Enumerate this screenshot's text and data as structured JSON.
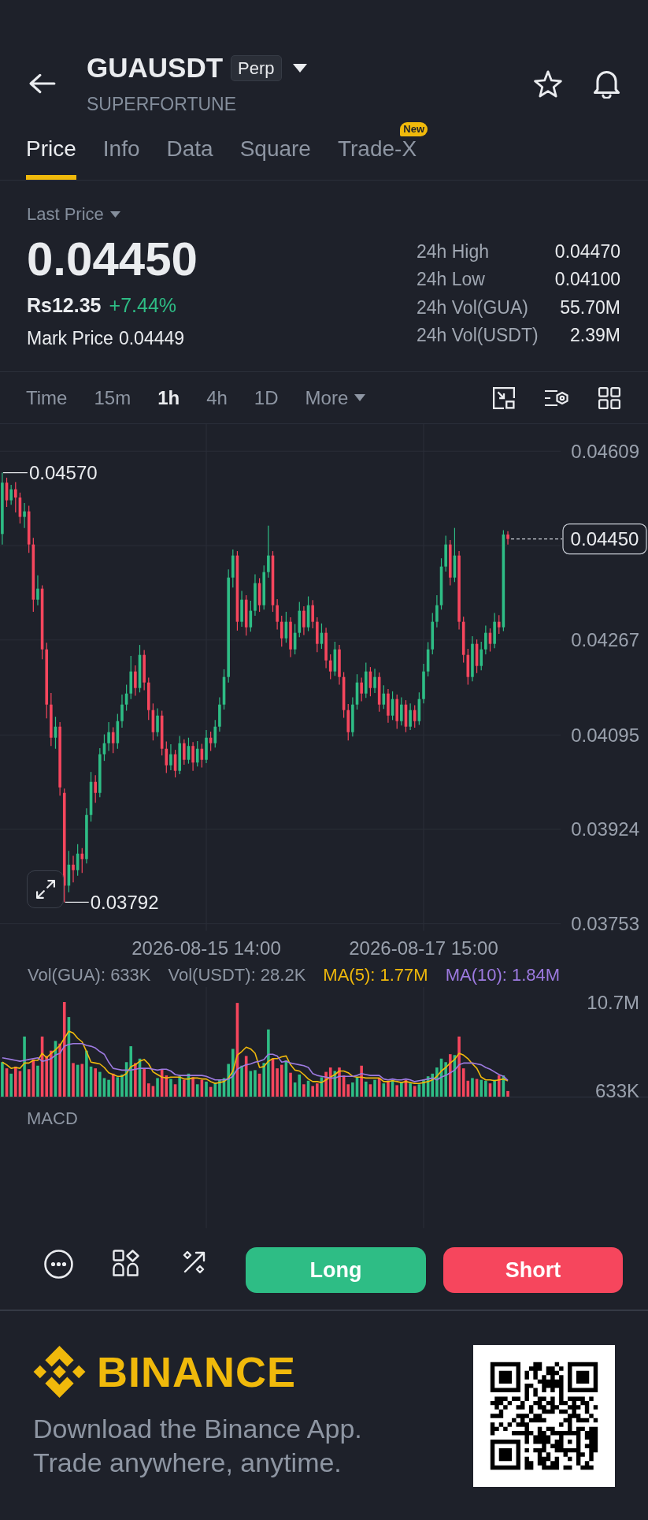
{
  "header": {
    "title": "GUAUSDT",
    "contract_type": "Perp",
    "subtitle": "SUPERFORTUNE"
  },
  "tabs": [
    {
      "label": "Price",
      "selected": true
    },
    {
      "label": "Info",
      "selected": false
    },
    {
      "label": "Data",
      "selected": false
    },
    {
      "label": "Square",
      "selected": false
    },
    {
      "label": "Trade-X",
      "selected": false,
      "badge": "New"
    }
  ],
  "summary": {
    "price_label": "Last Price",
    "last_price": "0.04450",
    "local_price": "Rs12.35",
    "change": "+7.44%",
    "mark_price_label": "Mark Price",
    "mark_price": "0.04449",
    "stats": [
      {
        "label": "24h High",
        "value": "0.04470"
      },
      {
        "label": "24h Low",
        "value": "0.04100"
      },
      {
        "label": "24h Vol(GUA)",
        "value": "55.70M"
      },
      {
        "label": "24h Vol(USDT)",
        "value": "2.39M"
      }
    ]
  },
  "intervals": [
    {
      "label": "Time",
      "kind": "option",
      "selected": false
    },
    {
      "label": "15m",
      "kind": "option",
      "selected": false
    },
    {
      "label": "1h",
      "kind": "option",
      "selected": true
    },
    {
      "label": "4h",
      "kind": "option",
      "selected": false
    },
    {
      "label": "1D",
      "kind": "option",
      "selected": false
    },
    {
      "label": "More",
      "kind": "dropdown",
      "selected": false
    }
  ],
  "chart": {
    "high_marker": "0.04570",
    "low_marker": "0.03792",
    "current_price": "0.04450",
    "chart_data": {
      "type": "candlestick",
      "grid": true,
      "ylim": [
        0.03753,
        0.04609
      ],
      "categories": [
        null,
        null,
        null,
        null,
        null,
        null,
        null,
        null,
        null,
        null,
        null,
        null,
        null,
        null,
        null,
        null,
        null,
        null,
        null,
        null,
        null,
        null,
        null,
        null,
        null,
        null,
        null,
        null,
        null,
        null,
        null,
        null,
        null,
        null,
        null,
        null,
        null,
        null,
        null,
        null,
        null,
        null,
        null,
        null,
        null,
        null,
        "2026-08-15 14:00",
        null,
        null,
        null,
        null,
        null,
        null,
        null,
        null,
        null,
        null,
        null,
        null,
        null,
        null,
        null,
        null,
        null,
        null,
        null,
        null,
        null,
        null,
        null,
        null,
        null,
        null,
        null,
        null,
        null,
        null,
        null,
        null,
        null,
        null,
        null,
        null,
        null,
        null,
        null,
        null,
        null,
        null,
        null,
        null,
        null,
        null,
        null,
        null,
        "2026-08-17 15:00",
        null,
        null,
        null,
        null,
        null,
        null,
        null,
        null,
        null,
        null,
        null,
        null,
        null,
        null,
        null,
        null,
        null,
        null,
        null
      ],
      "ohlc": [
        [
          0.04459,
          0.0457,
          0.0444,
          0.04552
        ],
        [
          0.04552,
          0.04561,
          0.04508,
          0.0452
        ],
        [
          0.0452,
          0.04548,
          0.04512,
          0.0454
        ],
        [
          0.0454,
          0.04553,
          0.04498,
          0.04525
        ],
        [
          0.04525,
          0.04534,
          0.04478,
          0.0449
        ],
        [
          0.0449,
          0.04515,
          0.0447,
          0.045
        ],
        [
          0.045,
          0.0451,
          0.04425,
          0.0444
        ],
        [
          0.0444,
          0.04452,
          0.04318,
          0.0434
        ],
        [
          0.0434,
          0.04384,
          0.0433,
          0.0436
        ],
        [
          0.0436,
          0.04366,
          0.04232,
          0.0425
        ],
        [
          0.0425,
          0.04262,
          0.04125,
          0.0415
        ],
        [
          0.0415,
          0.04171,
          0.04075,
          0.0409
        ],
        [
          0.0409,
          0.04128,
          0.0407,
          0.0411
        ],
        [
          0.0411,
          0.04118,
          0.03985,
          0.04
        ],
        [
          0.0399,
          0.03998,
          0.03792,
          0.03822
        ],
        [
          0.03822,
          0.03885,
          0.0381,
          0.0386
        ],
        [
          0.0386,
          0.03876,
          0.03828,
          0.0385
        ],
        [
          0.0385,
          0.03897,
          0.0384,
          0.0388
        ],
        [
          0.0388,
          0.0389,
          0.03845,
          0.0387
        ],
        [
          0.0387,
          0.03962,
          0.03862,
          0.0395
        ],
        [
          0.0395,
          0.04028,
          0.03938,
          0.0401
        ],
        [
          0.0401,
          0.04022,
          0.03972,
          0.0399
        ],
        [
          0.0399,
          0.04071,
          0.03982,
          0.0406
        ],
        [
          0.0406,
          0.04096,
          0.04048,
          0.0408
        ],
        [
          0.0408,
          0.04118,
          0.04066,
          0.041
        ],
        [
          0.041,
          0.04109,
          0.04062,
          0.0408
        ],
        [
          0.0408,
          0.04133,
          0.0407,
          0.0412
        ],
        [
          0.0412,
          0.04168,
          0.04108,
          0.0415
        ],
        [
          0.0415,
          0.04186,
          0.04139,
          0.0417
        ],
        [
          0.0417,
          0.04238,
          0.0416,
          0.0421
        ],
        [
          0.0421,
          0.04221,
          0.04166,
          0.0418
        ],
        [
          0.0418,
          0.04258,
          0.04172,
          0.0424
        ],
        [
          0.0424,
          0.04249,
          0.04176,
          0.0419
        ],
        [
          0.0419,
          0.04199,
          0.04122,
          0.0414
        ],
        [
          0.0414,
          0.04152,
          0.04085,
          0.041
        ],
        [
          0.041,
          0.04143,
          0.04092,
          0.0413
        ],
        [
          0.0413,
          0.04139,
          0.04058,
          0.0407
        ],
        [
          0.0407,
          0.04083,
          0.04026,
          0.0404
        ],
        [
          0.0404,
          0.04078,
          0.04031,
          0.0406
        ],
        [
          0.0406,
          0.04068,
          0.04018,
          0.0403
        ],
        [
          0.0403,
          0.04093,
          0.04024,
          0.0408
        ],
        [
          0.0408,
          0.04087,
          0.04041,
          0.0405
        ],
        [
          0.0405,
          0.0409,
          0.04043,
          0.04075
        ],
        [
          0.04075,
          0.04082,
          0.0403,
          0.04045
        ],
        [
          0.04045,
          0.04084,
          0.04038,
          0.0407
        ],
        [
          0.0407,
          0.04079,
          0.04036,
          0.0405
        ],
        [
          0.0405,
          0.04104,
          0.04044,
          0.0409
        ],
        [
          0.0409,
          0.04101,
          0.04066,
          0.0408
        ],
        [
          0.0408,
          0.04122,
          0.04072,
          0.0411
        ],
        [
          0.0411,
          0.04163,
          0.04101,
          0.0415
        ],
        [
          0.0415,
          0.04214,
          0.04141,
          0.042
        ],
        [
          0.042,
          0.04395,
          0.0419,
          0.0438
        ],
        [
          0.0438,
          0.04431,
          0.04362,
          0.0442
        ],
        [
          0.0442,
          0.04428,
          0.04284,
          0.043
        ],
        [
          0.043,
          0.04356,
          0.04291,
          0.0434
        ],
        [
          0.0434,
          0.04348,
          0.04275,
          0.0429
        ],
        [
          0.0429,
          0.04338,
          0.04282,
          0.0432
        ],
        [
          0.0432,
          0.04386,
          0.04311,
          0.0437
        ],
        [
          0.0437,
          0.04379,
          0.04318,
          0.0433
        ],
        [
          0.0433,
          0.04402,
          0.04322,
          0.0439
        ],
        [
          0.0439,
          0.04474,
          0.0438,
          0.0442
        ],
        [
          0.0442,
          0.04428,
          0.04318,
          0.0433
        ],
        [
          0.0433,
          0.04341,
          0.04286,
          0.043
        ],
        [
          0.043,
          0.04311,
          0.04255,
          0.0427
        ],
        [
          0.0427,
          0.04318,
          0.04262,
          0.043
        ],
        [
          0.043,
          0.04308,
          0.04236,
          0.0425
        ],
        [
          0.0425,
          0.04296,
          0.04241,
          0.0428
        ],
        [
          0.0428,
          0.04336,
          0.04272,
          0.0432
        ],
        [
          0.0432,
          0.04328,
          0.04276,
          0.0429
        ],
        [
          0.0429,
          0.04346,
          0.04283,
          0.0433
        ],
        [
          0.0433,
          0.04339,
          0.04288,
          0.043
        ],
        [
          0.043,
          0.04308,
          0.04245,
          0.0426
        ],
        [
          0.0426,
          0.04297,
          0.04251,
          0.0428
        ],
        [
          0.0428,
          0.04289,
          0.04216,
          0.0423
        ],
        [
          0.0423,
          0.04241,
          0.04196,
          0.0421
        ],
        [
          0.0421,
          0.04264,
          0.04202,
          0.0425
        ],
        [
          0.0425,
          0.04258,
          0.04186,
          0.042
        ],
        [
          0.042,
          0.04209,
          0.04126,
          0.0414
        ],
        [
          0.0414,
          0.04151,
          0.04085,
          0.041
        ],
        [
          0.041,
          0.04163,
          0.04092,
          0.0415
        ],
        [
          0.0415,
          0.04205,
          0.04141,
          0.0419
        ],
        [
          0.0419,
          0.04199,
          0.04156,
          0.0417
        ],
        [
          0.0417,
          0.04226,
          0.04162,
          0.0421
        ],
        [
          0.0421,
          0.04218,
          0.04165,
          0.0418
        ],
        [
          0.0418,
          0.04215,
          0.04171,
          0.042
        ],
        [
          0.042,
          0.04208,
          0.04137,
          0.0415
        ],
        [
          0.0415,
          0.04185,
          0.04142,
          0.0417
        ],
        [
          0.0417,
          0.04178,
          0.04117,
          0.0413
        ],
        [
          0.0413,
          0.04174,
          0.04122,
          0.0416
        ],
        [
          0.0416,
          0.04168,
          0.04106,
          0.0412
        ],
        [
          0.0412,
          0.04163,
          0.04112,
          0.0415
        ],
        [
          0.0415,
          0.04158,
          0.041,
          0.0411
        ],
        [
          0.0411,
          0.04152,
          0.04104,
          0.0414
        ],
        [
          0.0414,
          0.04149,
          0.04108,
          0.0412
        ],
        [
          0.0412,
          0.04172,
          0.04113,
          0.0416
        ],
        [
          0.0416,
          0.04224,
          0.04152,
          0.0421
        ],
        [
          0.0421,
          0.04263,
          0.04201,
          0.0425
        ],
        [
          0.0425,
          0.04316,
          0.04241,
          0.043
        ],
        [
          0.043,
          0.04348,
          0.0429,
          0.0433
        ],
        [
          0.0433,
          0.04415,
          0.04322,
          0.044
        ],
        [
          0.044,
          0.04456,
          0.04391,
          0.0444
        ],
        [
          0.0444,
          0.04448,
          0.04366,
          0.0438
        ],
        [
          0.0438,
          0.0447,
          0.04372,
          0.0442
        ],
        [
          0.0442,
          0.04428,
          0.04286,
          0.043
        ],
        [
          0.043,
          0.04309,
          0.04226,
          0.0424
        ],
        [
          0.0424,
          0.04251,
          0.04186,
          0.042
        ],
        [
          0.042,
          0.04274,
          0.04192,
          0.0426
        ],
        [
          0.0426,
          0.04268,
          0.04207,
          0.0422
        ],
        [
          0.0422,
          0.04264,
          0.04212,
          0.0425
        ],
        [
          0.0425,
          0.04293,
          0.04241,
          0.0428
        ],
        [
          0.0428,
          0.04288,
          0.04246,
          0.0426
        ],
        [
          0.0426,
          0.04316,
          0.04252,
          0.043
        ],
        [
          0.043,
          0.04312,
          0.04278,
          0.0429
        ],
        [
          0.0429,
          0.04466,
          0.04283,
          0.04458
        ],
        [
          0.04458,
          0.04464,
          0.0444,
          0.0445
        ]
      ],
      "yticks": [
        {
          "value": 0.04609,
          "label": "0.04609"
        },
        {
          "value": 0.04267,
          "label": "0.04267"
        },
        {
          "value": 0.04095,
          "label": "0.04095"
        },
        {
          "value": 0.03924,
          "label": "0.03924"
        },
        {
          "value": 0.03753,
          "label": "0.03753"
        }
      ]
    }
  },
  "volume": {
    "legend": [
      {
        "text": "Vol(GUA): 633K",
        "color": "#8e96a3"
      },
      {
        "text": "Vol(USDT): 28.2K",
        "color": "#8e96a3"
      },
      {
        "text": "MA(5): 1.77M",
        "color": "#f0b90b"
      },
      {
        "text": "MA(10): 1.84M",
        "color": "#9d7ae0"
      }
    ],
    "chart_data": {
      "type": "bar",
      "grid": true,
      "ylim": [
        0,
        10700000
      ],
      "categories": [
        null,
        null,
        null,
        null,
        null,
        null,
        null,
        null,
        null,
        null,
        null,
        null,
        null,
        null,
        null,
        null,
        null,
        null,
        null,
        null,
        null,
        null,
        null,
        null,
        null,
        null,
        null,
        null,
        null,
        null,
        null,
        null,
        null,
        null,
        null,
        null,
        null,
        null,
        null,
        null,
        null,
        null,
        null,
        null,
        null,
        null,
        null,
        null,
        null,
        null,
        null,
        null,
        null,
        null,
        null,
        null,
        null,
        null,
        null,
        null,
        null,
        null,
        null,
        null,
        null,
        null,
        null,
        null,
        null,
        null,
        null,
        null,
        null,
        null,
        null,
        null,
        null,
        null,
        null,
        null,
        null,
        null,
        null,
        null,
        null,
        null,
        null,
        null,
        null,
        null,
        null,
        null,
        null,
        null,
        null,
        null,
        null,
        null,
        null,
        null,
        null,
        null,
        null,
        null,
        null,
        null,
        null,
        null,
        null,
        null,
        null,
        null,
        null,
        null,
        null
      ],
      "series": [
        {
          "type": "bar",
          "values": [
            3900000,
            3200000,
            2600000,
            3400000,
            2900000,
            6800000,
            3100000,
            4200000,
            3500000,
            6800000,
            4600000,
            5200000,
            6300000,
            6000000,
            10700000,
            9000000,
            3800000,
            3600000,
            3700000,
            5200000,
            3400000,
            3200000,
            2800000,
            2100000,
            1900000,
            2600000,
            2200000,
            2500000,
            3900000,
            5700000,
            3800000,
            4300000,
            3200000,
            1500000,
            1200000,
            2100000,
            3100000,
            2400000,
            2000000,
            1400000,
            2300000,
            1900000,
            2600000,
            2200000,
            1400000,
            1900000,
            1700000,
            1100000,
            1600000,
            1900000,
            2100000,
            3700000,
            5400000,
            10600000,
            3500000,
            4600000,
            2900000,
            3000000,
            2600000,
            3800000,
            7600000,
            4300000,
            3200000,
            3600000,
            4100000,
            2700000,
            1600000,
            2500000,
            1400000,
            1800000,
            1200000,
            1500000,
            2200000,
            2800000,
            3300000,
            2900000,
            3300000,
            2400000,
            1400000,
            1600000,
            2200000,
            3500000,
            1700000,
            1400000,
            1900000,
            2100000,
            1500000,
            1800000,
            1900000,
            1300000,
            1600000,
            1900000,
            1500000,
            1200000,
            1400000,
            1900000,
            2300000,
            2600000,
            3300000,
            4300000,
            3900000,
            4800000,
            4700000,
            6800000,
            3200000,
            1800000,
            2100000,
            2000000,
            1900000,
            1800000,
            1500000,
            1900000,
            2400000,
            2400000,
            633000
          ],
          "colors": [
            "#2ebd85",
            "#f6465d",
            "#2ebd85",
            "#f6465d",
            "#f6465d",
            "#2ebd85",
            "#f6465d",
            "#f6465d",
            "#2ebd85",
            "#f6465d",
            "#f6465d",
            "#f6465d",
            "#2ebd85",
            "#f6465d",
            "#f6465d",
            "#2ebd85",
            "#f6465d",
            "#2ebd85",
            "#f6465d",
            "#2ebd85",
            "#2ebd85",
            "#f6465d",
            "#2ebd85",
            "#2ebd85",
            "#2ebd85",
            "#f6465d",
            "#2ebd85",
            "#2ebd85",
            "#2ebd85",
            "#2ebd85",
            "#f6465d",
            "#2ebd85",
            "#f6465d",
            "#f6465d",
            "#f6465d",
            "#2ebd85",
            "#f6465d",
            "#f6465d",
            "#2ebd85",
            "#f6465d",
            "#2ebd85",
            "#f6465d",
            "#2ebd85",
            "#f6465d",
            "#2ebd85",
            "#f6465d",
            "#2ebd85",
            "#f6465d",
            "#2ebd85",
            "#2ebd85",
            "#2ebd85",
            "#2ebd85",
            "#2ebd85",
            "#f6465d",
            "#2ebd85",
            "#f6465d",
            "#2ebd85",
            "#2ebd85",
            "#f6465d",
            "#2ebd85",
            "#2ebd85",
            "#f6465d",
            "#f6465d",
            "#f6465d",
            "#2ebd85",
            "#f6465d",
            "#2ebd85",
            "#2ebd85",
            "#f6465d",
            "#2ebd85",
            "#f6465d",
            "#f6465d",
            "#2ebd85",
            "#f6465d",
            "#f6465d",
            "#2ebd85",
            "#f6465d",
            "#f6465d",
            "#f6465d",
            "#2ebd85",
            "#2ebd85",
            "#f6465d",
            "#2ebd85",
            "#f6465d",
            "#2ebd85",
            "#f6465d",
            "#2ebd85",
            "#f6465d",
            "#2ebd85",
            "#f6465d",
            "#2ebd85",
            "#f6465d",
            "#2ebd85",
            "#f6465d",
            "#2ebd85",
            "#2ebd85",
            "#2ebd85",
            "#2ebd85",
            "#2ebd85",
            "#2ebd85",
            "#2ebd85",
            "#f6465d",
            "#2ebd85",
            "#f6465d",
            "#f6465d",
            "#f6465d",
            "#2ebd85",
            "#f6465d",
            "#2ebd85",
            "#2ebd85",
            "#f6465d",
            "#2ebd85",
            "#f6465d",
            "#2ebd85",
            "#f6465d"
          ]
        },
        {
          "type": "line",
          "color": "#f0b90b",
          "values": [
            3900000,
            3600000,
            3200000,
            3300000,
            3200000,
            3800000,
            3800000,
            4100000,
            4100000,
            4900000,
            4400000,
            4900000,
            5300000,
            5800000,
            6600000,
            7400000,
            7200000,
            6600000,
            6200000,
            5100000,
            3900000,
            3800000,
            3700000,
            3300000,
            2700000,
            2500000,
            2300000,
            2300000,
            2600000,
            3400000,
            3600000,
            4000000,
            4200000,
            3700000,
            2800000,
            2500000,
            2200000,
            2100000,
            2200000,
            2200000,
            2200000,
            2000000,
            2000000,
            2100000,
            2100000,
            2000000,
            2000000,
            1700000,
            1500000,
            1600000,
            1700000,
            2100000,
            2900000,
            4700000,
            5100000,
            5600000,
            5400000,
            4900000,
            3300000,
            3400000,
            4000000,
            4300000,
            4300000,
            4500000,
            4600000,
            3600000,
            3000000,
            2900000,
            2500000,
            2000000,
            1700000,
            1700000,
            1600000,
            1900000,
            2200000,
            2500000,
            2900000,
            2900000,
            2700000,
            2300000,
            2200000,
            2200000,
            2100000,
            2100000,
            2100000,
            2100000,
            1700000,
            1700000,
            1800000,
            1700000,
            1600000,
            1700000,
            1600000,
            1500000,
            1500000,
            1600000,
            1700000,
            1900000,
            2300000,
            2900000,
            3300000,
            3800000,
            4200000,
            4900000,
            4700000,
            4300000,
            3700000,
            3200000,
            2200000,
            1900000,
            1900000,
            1800000,
            1900000,
            2000000,
            1770000
          ]
        },
        {
          "type": "line",
          "color": "#9d7ae0",
          "values": [
            4400000,
            4300000,
            4200000,
            4100000,
            4000000,
            4100000,
            4200000,
            4300000,
            4400000,
            4000000,
            4100000,
            4300000,
            4700000,
            4900000,
            5700000,
            5900000,
            6000000,
            6000000,
            6000000,
            5800000,
            5700000,
            5500000,
            5100000,
            4800000,
            3900000,
            3200000,
            3100000,
            3000000,
            3000000,
            3000000,
            3100000,
            3200000,
            3200000,
            3200000,
            3100000,
            3000000,
            3100000,
            3100000,
            2900000,
            2500000,
            2400000,
            2400000,
            2400000,
            2400000,
            2400000,
            2400000,
            2300000,
            2100000,
            1900000,
            1900000,
            1900000,
            2000000,
            2300000,
            3100000,
            3400000,
            3600000,
            3700000,
            3900000,
            4000000,
            4200000,
            4800000,
            4800000,
            4600000,
            3900000,
            4000000,
            3800000,
            3700000,
            3600000,
            3500000,
            3300000,
            2600000,
            2400000,
            2300000,
            2200000,
            2100000,
            2100000,
            2300000,
            2300000,
            2300000,
            2300000,
            2400000,
            2600000,
            2500000,
            2400000,
            2400000,
            2400000,
            2000000,
            1900000,
            2000000,
            1900000,
            1900000,
            2000000,
            1900000,
            1700000,
            1800000,
            1900000,
            2000000,
            2100000,
            1900000,
            2200000,
            2400000,
            2700000,
            3000000,
            3600000,
            3800000,
            3800000,
            3800000,
            3700000,
            3600000,
            3300000,
            3100000,
            2800000,
            2500000,
            2300000,
            1840000
          ]
        }
      ],
      "yticks": [
        {
          "value": 10700000,
          "label": "10.7M"
        },
        {
          "value": 633000,
          "label": "633K"
        }
      ]
    }
  },
  "indicator": {
    "label": "MACD"
  },
  "actions": [
    {
      "label": "Long",
      "kind": "long"
    },
    {
      "label": "Short",
      "kind": "short"
    }
  ],
  "footer": {
    "brand": "BINANCE",
    "lines": [
      "Download the Binance App.",
      "Trade anywhere, anytime."
    ]
  }
}
